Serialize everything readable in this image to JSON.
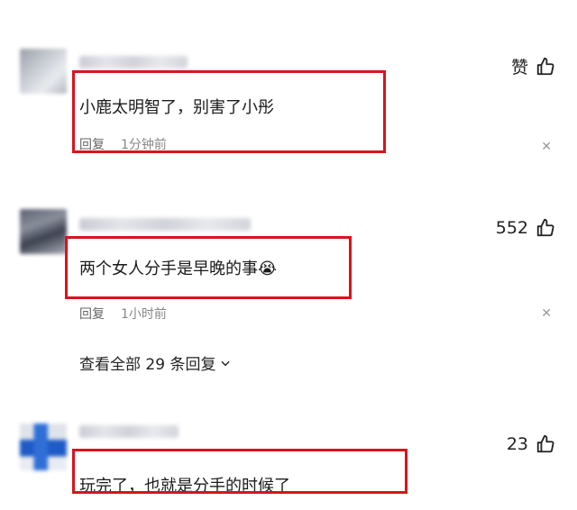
{
  "comments": [
    {
      "text": "小鹿太明智了，别害了小彤",
      "reply_label": "回复",
      "time": "1分钟前",
      "like_label": "赞"
    },
    {
      "text": "两个女人分手是早晚的事",
      "emoji": "😭",
      "reply_label": "回复",
      "time": "1小时前",
      "like_count": "552",
      "view_replies": "查看全部 29 条回复"
    },
    {
      "text": "玩完了，也就是分手的时候了",
      "like_count": "23"
    }
  ],
  "colors": {
    "highlight_box": "#d8141d",
    "muted_text": "#888888"
  }
}
